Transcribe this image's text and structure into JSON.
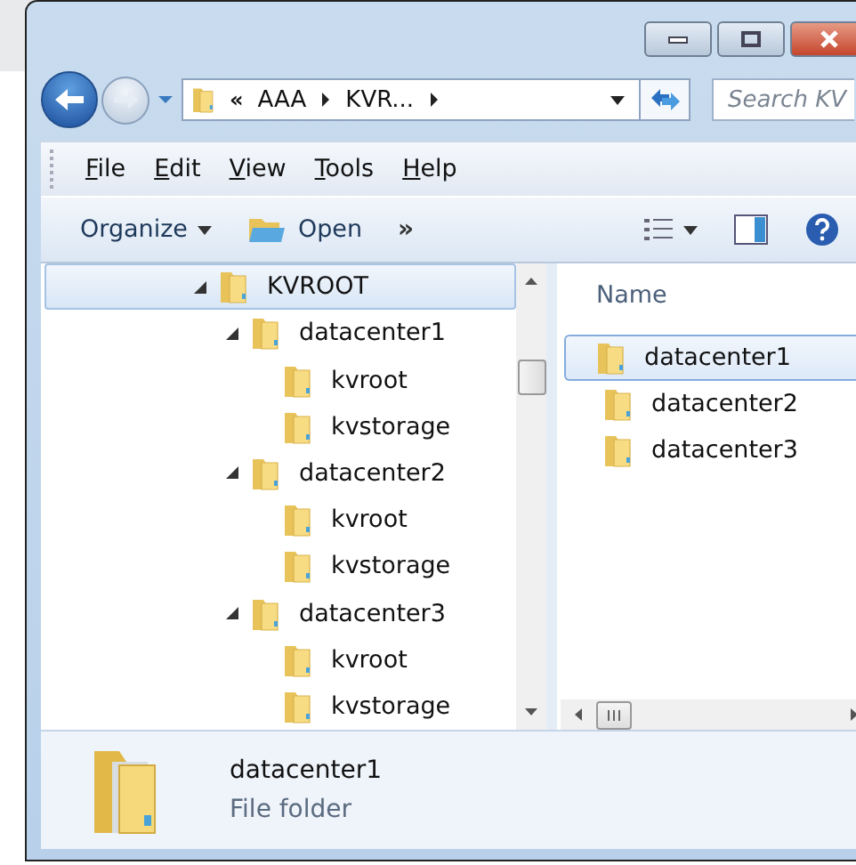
{
  "address_bar": {
    "overflow": "«",
    "crumbs": [
      "AAA",
      "KVR..."
    ]
  },
  "search": {
    "placeholder": "Search KV"
  },
  "menu_bar": [
    "File",
    "Edit",
    "View",
    "Tools",
    "Help"
  ],
  "command_bar": {
    "organize": "Organize",
    "open": "Open",
    "more": "»"
  },
  "tree": [
    {
      "label": "KVROOT",
      "selected": true,
      "expanded": true,
      "children": [
        {
          "label": "datacenter1",
          "selected": false,
          "expanded": true,
          "children": [
            {
              "label": "kvroot",
              "selected": false
            },
            {
              "label": "kvstorage",
              "selected": false
            }
          ]
        },
        {
          "label": "datacenter2",
          "selected": false,
          "expanded": true,
          "children": [
            {
              "label": "kvroot",
              "selected": false
            },
            {
              "label": "kvstorage",
              "selected": false
            }
          ]
        },
        {
          "label": "datacenter3",
          "selected": false,
          "expanded": true,
          "children": [
            {
              "label": "kvroot",
              "selected": false
            },
            {
              "label": "kvstorage",
              "selected": false
            }
          ]
        }
      ]
    }
  ],
  "file_list": {
    "column": "Name",
    "items": [
      {
        "name": "datacenter1",
        "selected": true
      },
      {
        "name": "datacenter2",
        "selected": false
      },
      {
        "name": "datacenter3",
        "selected": false
      }
    ]
  },
  "details": {
    "name": "datacenter1",
    "type": "File folder"
  }
}
